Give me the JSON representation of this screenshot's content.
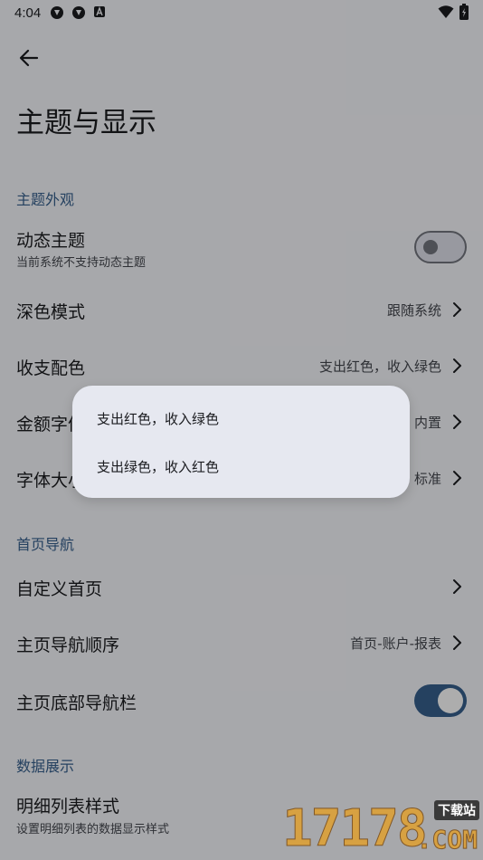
{
  "status_bar": {
    "time": "4:04",
    "icons": [
      "app-notification-icon",
      "app-notification-icon",
      "a-badge-icon",
      "wifi-icon",
      "battery-icon"
    ]
  },
  "header": {
    "title": "主题与显示",
    "back_icon": "arrow-back-icon"
  },
  "sections": {
    "theme": {
      "header": "主题外观",
      "dynamic_theme": {
        "title": "动态主题",
        "subtitle": "当前系统不支持动态主题",
        "toggle": "off"
      },
      "dark_mode": {
        "title": "深色模式",
        "value": "跟随系统"
      },
      "income_color": {
        "title": "收支配色",
        "value": "支出红色，收入绿色"
      },
      "amount_font": {
        "title": "金额字体",
        "value": "内置"
      },
      "font_size": {
        "title": "字体大小",
        "value": "标准"
      }
    },
    "home_nav": {
      "header": "首页导航",
      "custom_home": {
        "title": "自定义首页"
      },
      "nav_order": {
        "title": "主页导航顺序",
        "value": "首页-账户-报表"
      },
      "bottom_nav": {
        "title": "主页底部导航栏",
        "toggle": "on"
      }
    },
    "data_display": {
      "header": "数据展示",
      "detail_list_style": {
        "title": "明细列表样式",
        "subtitle": "设置明细列表的数据显示样式"
      }
    }
  },
  "popup_menu": {
    "items": [
      "支出红色，收入绿色",
      "支出绿色，收入红色"
    ]
  },
  "watermark": {
    "digits": "17178",
    "suffix": ".COM",
    "tag": "下载站"
  },
  "colors": {
    "accent": "#37618e",
    "background": "#f7f8fc",
    "menu": "#e6e8f0"
  }
}
